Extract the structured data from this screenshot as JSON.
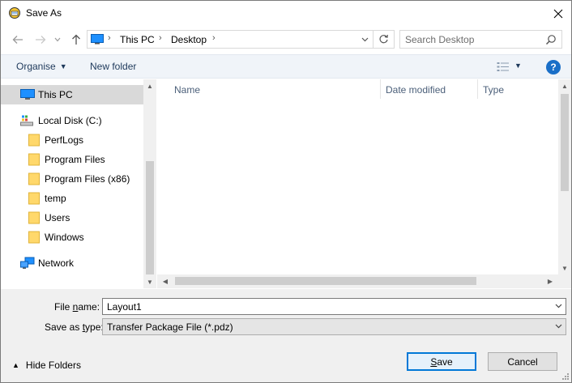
{
  "window": {
    "title": "Save As"
  },
  "address": {
    "crumbs": [
      "This PC",
      "Desktop"
    ]
  },
  "search": {
    "placeholder": "Search Desktop"
  },
  "toolbar": {
    "organise_label": "Organise",
    "new_folder_label": "New folder",
    "help_label": "?"
  },
  "nav": {
    "items": [
      {
        "label": "This PC",
        "icon": "computer-icon",
        "selected": true
      },
      {
        "label": "Local Disk (C:)",
        "icon": "drive-icon"
      },
      {
        "label": "PerfLogs",
        "icon": "folder-icon"
      },
      {
        "label": "Program Files",
        "icon": "folder-icon"
      },
      {
        "label": "Program Files (x86)",
        "icon": "folder-icon"
      },
      {
        "label": "temp",
        "icon": "folder-icon"
      },
      {
        "label": "Users",
        "icon": "folder-icon"
      },
      {
        "label": "Windows",
        "icon": "folder-icon"
      },
      {
        "label": "Network",
        "icon": "network-icon"
      }
    ]
  },
  "columns": {
    "name": "Name",
    "date_modified": "Date modified",
    "type": "Type"
  },
  "form": {
    "file_name_label_pre": "File ",
    "file_name_label_ul": "n",
    "file_name_label_post": "ame:",
    "file_name_value": "Layout1",
    "save_type_label_pre": "Save as ",
    "save_type_label_ul": "t",
    "save_type_label_post": "ype:",
    "save_type_value": "Transfer Package File (*.pdz)"
  },
  "footer": {
    "hide_folders_label": "Hide Folders",
    "save_label_ul": "S",
    "save_label_rest": "ave",
    "cancel_label": "Cancel"
  },
  "colors": {
    "accent": "#0078d7",
    "toolbar_text": "#1e395b",
    "help": "#1a6fc8",
    "folder": "#ffd86b"
  }
}
